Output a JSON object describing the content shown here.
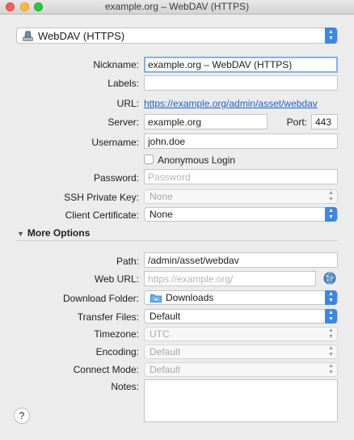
{
  "window": {
    "title": "example.org – WebDAV (HTTPS)"
  },
  "protocol": {
    "value": "WebDAV (HTTPS)",
    "icon": "disk-icon"
  },
  "nickname": {
    "label": "Nickname:",
    "value": "example.org – WebDAV (HTTPS)"
  },
  "labels": {
    "label": "Labels:",
    "value": ""
  },
  "url": {
    "label": "URL:",
    "value": "https://example.org/admin/asset/webdav"
  },
  "server": {
    "label": "Server:",
    "value": "example.org"
  },
  "port": {
    "label": "Port:",
    "value": "443"
  },
  "username": {
    "label": "Username:",
    "value": "john.doe"
  },
  "anonymous": {
    "label": "Anonymous Login",
    "checked": false
  },
  "password": {
    "label": "Password:",
    "placeholder": "Password"
  },
  "ssh_key": {
    "label": "SSH Private Key:",
    "value": "None"
  },
  "client_cert": {
    "label": "Client Certificate:",
    "value": "None"
  },
  "more_options": {
    "label": "More Options"
  },
  "path": {
    "label": "Path:",
    "value": "/admin/asset/webdav"
  },
  "web_url": {
    "label": "Web URL:",
    "placeholder": "https://example.org/"
  },
  "download_folder": {
    "label": "Download Folder:",
    "value": "Downloads"
  },
  "transfer_files": {
    "label": "Transfer Files:",
    "value": "Default"
  },
  "timezone": {
    "label": "Timezone:",
    "value": "UTC"
  },
  "encoding": {
    "label": "Encoding:",
    "value": "Default"
  },
  "connect_mode": {
    "label": "Connect Mode:",
    "value": "Default"
  },
  "notes": {
    "label": "Notes:",
    "value": ""
  },
  "help": {
    "label": "?"
  },
  "colors": {
    "accent": "#3a86ea",
    "link": "#1a5fcf",
    "focus": "#7fb2ef"
  }
}
